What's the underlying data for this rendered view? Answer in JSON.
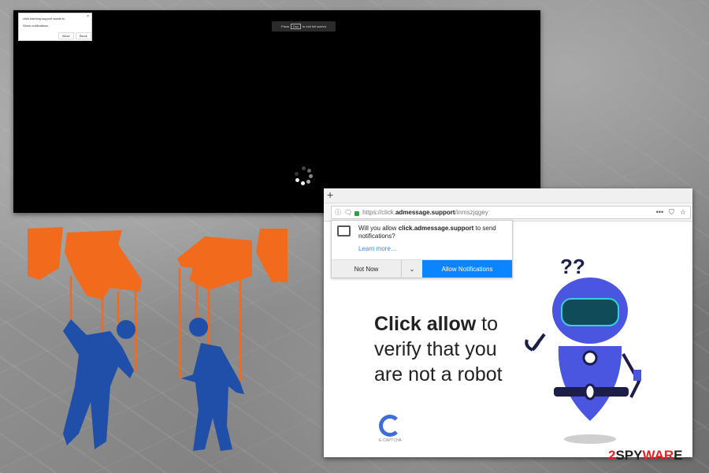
{
  "fullscreen_window": {
    "notification_popup": {
      "title": "click.warning.support wants to",
      "row_text": "Show notifications",
      "allow_label": "Allow",
      "block_label": "Block",
      "close": "×"
    },
    "fullscreen_banner": {
      "press": "Press",
      "key": "Esc",
      "suffix": "to exit full screen"
    }
  },
  "browser": {
    "new_tab": "+",
    "url": {
      "prefix": "https://click.",
      "domain": "admessage.support",
      "path": "/inmszjqgey"
    },
    "toolbar_icons": [
      "more-icon",
      "pocket-icon",
      "bookmark-star-icon"
    ],
    "notification_prompt": {
      "question_pre": "Will you allow ",
      "question_domain": "click.admessage.support",
      "question_post": " to send notifications?",
      "learn_more": "Learn more…",
      "not_now": "Not Now",
      "allow": "Allow Notifications"
    },
    "page": {
      "headline_bold": "Click allow",
      "headline_rest": " to",
      "line2": "verify that you",
      "line3": "are not a robot",
      "captcha_label": "E-CAPTCHA",
      "robot_text": "??"
    }
  },
  "watermark": {
    "part1": "2",
    "part2": "SPY",
    "part3": "WAR",
    "part4": "E"
  },
  "colors": {
    "accent": "#0a84ff",
    "robot": "#4a55e0",
    "orange": "#f26a1b",
    "puppet_blue": "#1f4fa8"
  }
}
